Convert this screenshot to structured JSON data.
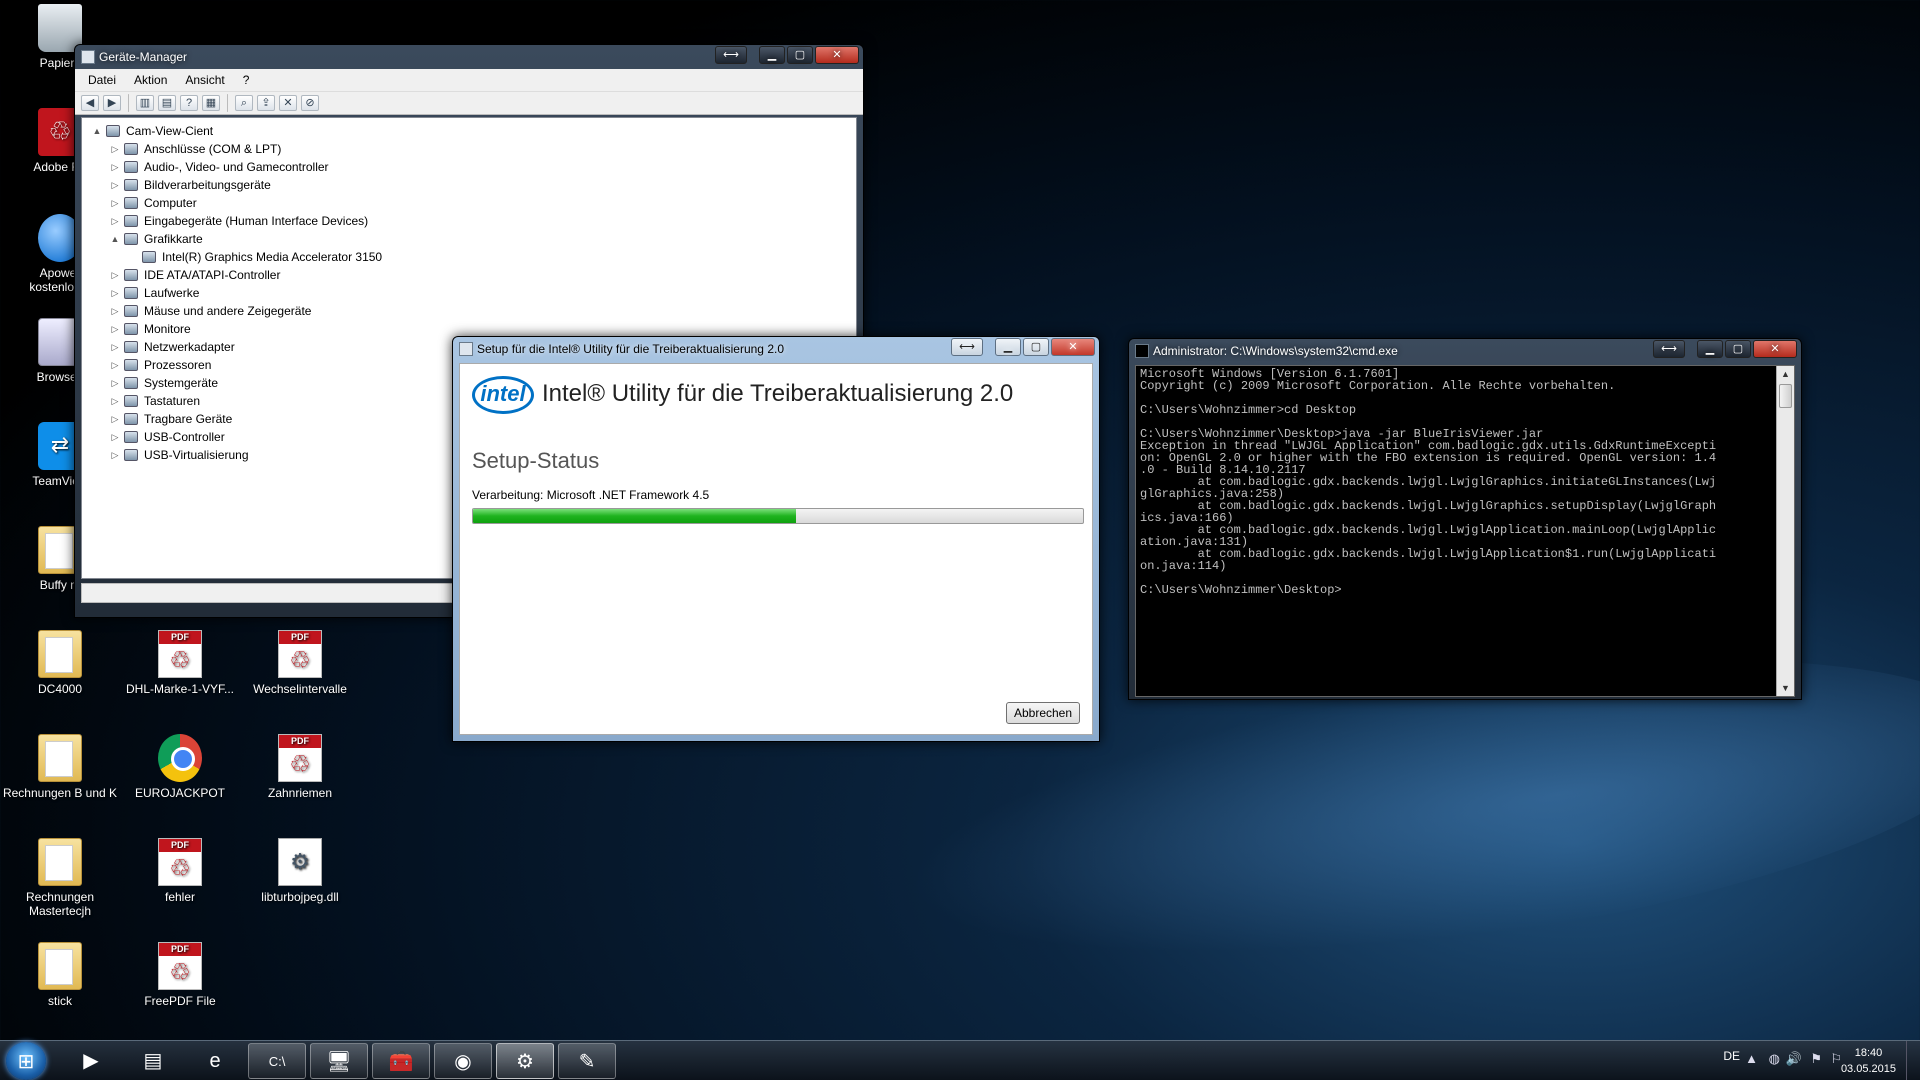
{
  "desktop": {
    "icons": [
      {
        "label": "Papierk",
        "kind": "trash"
      },
      {
        "label": "Adobe Re",
        "kind": "acrobat"
      },
      {
        "label": "Apower\nkostenloser",
        "kind": "globe"
      },
      {
        "label": "Browsen",
        "kind": "generic"
      },
      {
        "label": "TeamView",
        "kind": "teamviewer"
      },
      {
        "label": "Buffy m",
        "kind": "folder"
      },
      {
        "label": "DC4000",
        "kind": "folder"
      },
      {
        "label": "DHL-Marke-1-VYF...",
        "kind": "pdf"
      },
      {
        "label": "Wechselintervalle",
        "kind": "pdf"
      },
      {
        "label": "Rechnungen B und K",
        "kind": "folder"
      },
      {
        "label": "EUROJACKPOT",
        "kind": "chrome"
      },
      {
        "label": "Zahnriemen",
        "kind": "pdf"
      },
      {
        "label": "Rechnungen Mastertecjh",
        "kind": "folder"
      },
      {
        "label": "fehler",
        "kind": "pdf"
      },
      {
        "label": "libturbojpeg.dll",
        "kind": "dll"
      },
      {
        "label": "stick",
        "kind": "folder"
      },
      {
        "label": "FreePDF File",
        "kind": "pdf"
      }
    ]
  },
  "device_manager": {
    "title": "Geräte-Manager",
    "menu": [
      "Datei",
      "Aktion",
      "Ansicht",
      "?"
    ],
    "tree": [
      {
        "label": "Cam-View-Cient",
        "level": 0,
        "expander": "▲"
      },
      {
        "label": "Anschlüsse (COM & LPT)",
        "level": 1,
        "expander": "▷"
      },
      {
        "label": "Audio-, Video- und Gamecontroller",
        "level": 1,
        "expander": "▷"
      },
      {
        "label": "Bildverarbeitungsgeräte",
        "level": 1,
        "expander": "▷"
      },
      {
        "label": "Computer",
        "level": 1,
        "expander": "▷"
      },
      {
        "label": "Eingabegeräte (Human Interface Devices)",
        "level": 1,
        "expander": "▷"
      },
      {
        "label": "Grafikkarte",
        "level": 1,
        "expander": "▲"
      },
      {
        "label": "Intel(R) Graphics Media Accelerator 3150",
        "level": 2,
        "expander": ""
      },
      {
        "label": "IDE ATA/ATAPI-Controller",
        "level": 1,
        "expander": "▷"
      },
      {
        "label": "Laufwerke",
        "level": 1,
        "expander": "▷"
      },
      {
        "label": "Mäuse und andere Zeigegeräte",
        "level": 1,
        "expander": "▷"
      },
      {
        "label": "Monitore",
        "level": 1,
        "expander": "▷"
      },
      {
        "label": "Netzwerkadapter",
        "level": 1,
        "expander": "▷"
      },
      {
        "label": "Prozessoren",
        "level": 1,
        "expander": "▷"
      },
      {
        "label": "Systemgeräte",
        "level": 1,
        "expander": "▷"
      },
      {
        "label": "Tastaturen",
        "level": 1,
        "expander": "▷"
      },
      {
        "label": "Tragbare Geräte",
        "level": 1,
        "expander": "▷"
      },
      {
        "label": "USB-Controller",
        "level": 1,
        "expander": "▷"
      },
      {
        "label": "USB-Virtualisierung",
        "level": 1,
        "expander": "▷"
      }
    ]
  },
  "setup": {
    "window_title": "Setup für die Intel® Utility für die Treiberaktualisierung 2.0",
    "logo": "intel",
    "heading": "Intel® Utility für die Treiberaktualisierung 2.0",
    "status_heading": "Setup-Status",
    "processing": "Verarbeitung: Microsoft .NET Framework 4.5",
    "progress": 0.53,
    "cancel_label": "Abbrechen"
  },
  "cmd": {
    "title": "Administrator: C:\\Windows\\system32\\cmd.exe",
    "text": "Microsoft Windows [Version 6.1.7601]\nCopyright (c) 2009 Microsoft Corporation. Alle Rechte vorbehalten.\n\nC:\\Users\\Wohnzimmer>cd Desktop\n\nC:\\Users\\Wohnzimmer\\Desktop>java -jar BlueIrisViewer.jar\nException in thread \"LWJGL Application\" com.badlogic.gdx.utils.GdxRuntimeExcepti\non: OpenGL 2.0 or higher with the FBO extension is required. OpenGL version: 1.4\n.0 - Build 8.14.10.2117\n        at com.badlogic.gdx.backends.lwjgl.LwjglGraphics.initiateGLInstances(Lwj\nglGraphics.java:258)\n        at com.badlogic.gdx.backends.lwjgl.LwjglGraphics.setupDisplay(LwjglGraph\nics.java:166)\n        at com.badlogic.gdx.backends.lwjgl.LwjglApplication.mainLoop(LwjglApplic\nation.java:131)\n        at com.badlogic.gdx.backends.lwjgl.LwjglApplication$1.run(LwjglApplicati\non.java:114)\n\nC:\\Users\\Wohnzimmer\\Desktop>"
  },
  "taskbar": {
    "items": [
      {
        "name": "media-player-icon",
        "glyph": "▶",
        "state": ""
      },
      {
        "name": "explorer-icon",
        "glyph": "▤",
        "state": ""
      },
      {
        "name": "internet-explorer-icon",
        "glyph": "e",
        "state": ""
      },
      {
        "name": "cmd-icon",
        "glyph": "C:\\",
        "state": "running"
      },
      {
        "name": "device-manager-icon",
        "glyph": "🖥",
        "state": "running"
      },
      {
        "name": "toolbox-icon",
        "glyph": "🧰",
        "state": "running"
      },
      {
        "name": "chrome-icon",
        "glyph": "◉",
        "state": "running"
      },
      {
        "name": "setup-icon",
        "glyph": "⚙",
        "state": "active"
      },
      {
        "name": "paint-icon",
        "glyph": "✎",
        "state": "running"
      }
    ],
    "language": "DE",
    "time": "18:40",
    "date": "03.05.2015"
  }
}
